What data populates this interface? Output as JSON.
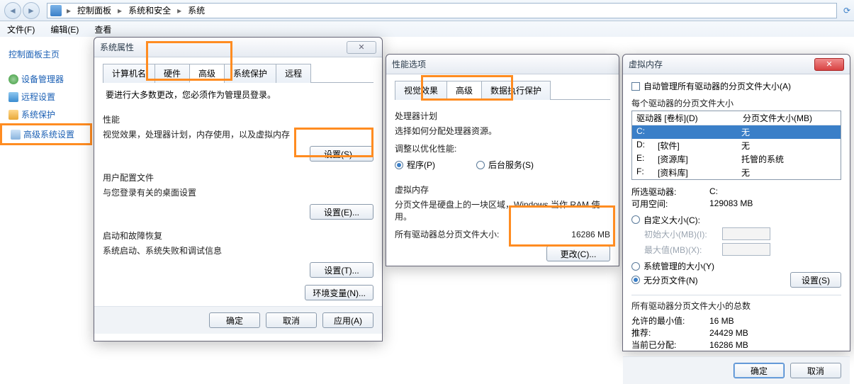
{
  "explorer": {
    "breadcrumb": [
      "控制面板",
      "系统和安全",
      "系统"
    ]
  },
  "menubar": [
    "文件(F)",
    "编辑(E)",
    "查看"
  ],
  "sidebar": {
    "home": "控制面板主页",
    "items": [
      {
        "label": "设备管理器"
      },
      {
        "label": "远程设置"
      },
      {
        "label": "系统保护"
      },
      {
        "label": "高级系统设置",
        "highlight": true
      }
    ]
  },
  "sysprops": {
    "title": "系统属性",
    "tabs": [
      "计算机名",
      "硬件",
      "高级",
      "系统保护",
      "远程"
    ],
    "active_tab": "高级",
    "admin_text": "要进行大多数更改，您必须作为管理员登录。",
    "perf": {
      "legend": "性能",
      "desc": "视觉效果，处理器计划，内存使用，以及虚拟内存",
      "btn": "设置(S)..."
    },
    "userprof": {
      "legend": "用户配置文件",
      "desc": "与您登录有关的桌面设置",
      "btn": "设置(E)..."
    },
    "startup": {
      "legend": "启动和故障恢复",
      "desc": "系统启动、系统失败和调试信息",
      "btn": "设置(T)..."
    },
    "env_btn": "环境变量(N)...",
    "ok": "确定",
    "cancel": "取消",
    "apply": "应用(A)"
  },
  "perfopts": {
    "title": "性能选项",
    "tabs": [
      "视觉效果",
      "高级",
      "数据执行保护"
    ],
    "active_tab": "高级",
    "sched": {
      "legend": "处理器计划",
      "desc": "选择如何分配处理器资源。",
      "adjust": "调整以优化性能:",
      "prog": "程序(P)",
      "bg": "后台服务(S)"
    },
    "vm": {
      "legend": "虚拟内存",
      "desc": "分页文件是硬盘上的一块区域，Windows 当作 RAM 使用。",
      "total_label": "所有驱动器总分页文件大小:",
      "total_value": "16286 MB",
      "btn": "更改(C)..."
    }
  },
  "vmem": {
    "title": "虚拟内存",
    "auto": "自动管理所有驱动器的分页文件大小(A)",
    "each_label": "每个驱动器的分页文件大小",
    "col_drive": "驱动器 [卷标](D)",
    "col_size": "分页文件大小(MB)",
    "drives": [
      {
        "d": "C:",
        "label": "",
        "size": "无"
      },
      {
        "d": "D:",
        "label": "[软件]",
        "size": "无"
      },
      {
        "d": "E:",
        "label": "[资源库]",
        "size": "托管的系统"
      },
      {
        "d": "F:",
        "label": "[资料库]",
        "size": "无"
      }
    ],
    "selected_drive_label": "所选驱动器:",
    "selected_drive": "C:",
    "avail_label": "可用空间:",
    "avail": "129083 MB",
    "custom": "自定义大小(C):",
    "init": "初始大小(MB)(I):",
    "max": "最大值(MB)(X):",
    "sys_managed": "系统管理的大小(Y)",
    "no_paging": "无分页文件(N)",
    "set_btn": "设置(S)",
    "total_legend": "所有驱动器分页文件大小的总数",
    "min_label": "允许的最小值:",
    "min": "16 MB",
    "rec_label": "推荐:",
    "rec": "24429 MB",
    "cur_label": "当前已分配:",
    "cur": "16286 MB",
    "ok": "确定",
    "cancel": "取消"
  }
}
